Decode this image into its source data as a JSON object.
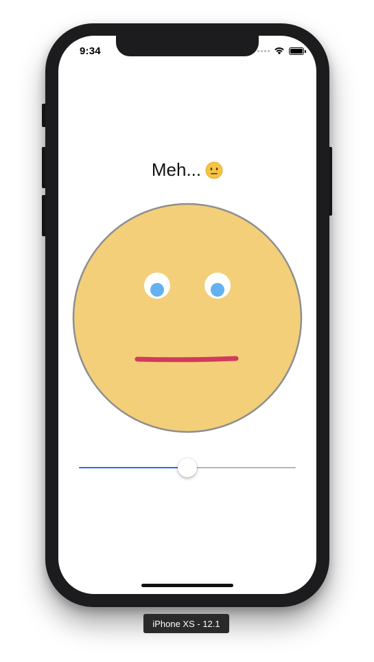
{
  "status_bar": {
    "time": "9:34"
  },
  "mood": {
    "label": "Meh...",
    "emoji_icon": "neutral-face-emoji"
  },
  "slider": {
    "value": 0.5
  },
  "device": {
    "label": "iPhone XS - 12.1"
  },
  "colors": {
    "face_fill": "#f3cf7a",
    "face_stroke": "#8e8e8e",
    "iris": "#63b2ef",
    "mouth": "#d23a5b",
    "slider_min_track": "#1a73e8",
    "slider_max_track": "#b6b6b6"
  }
}
